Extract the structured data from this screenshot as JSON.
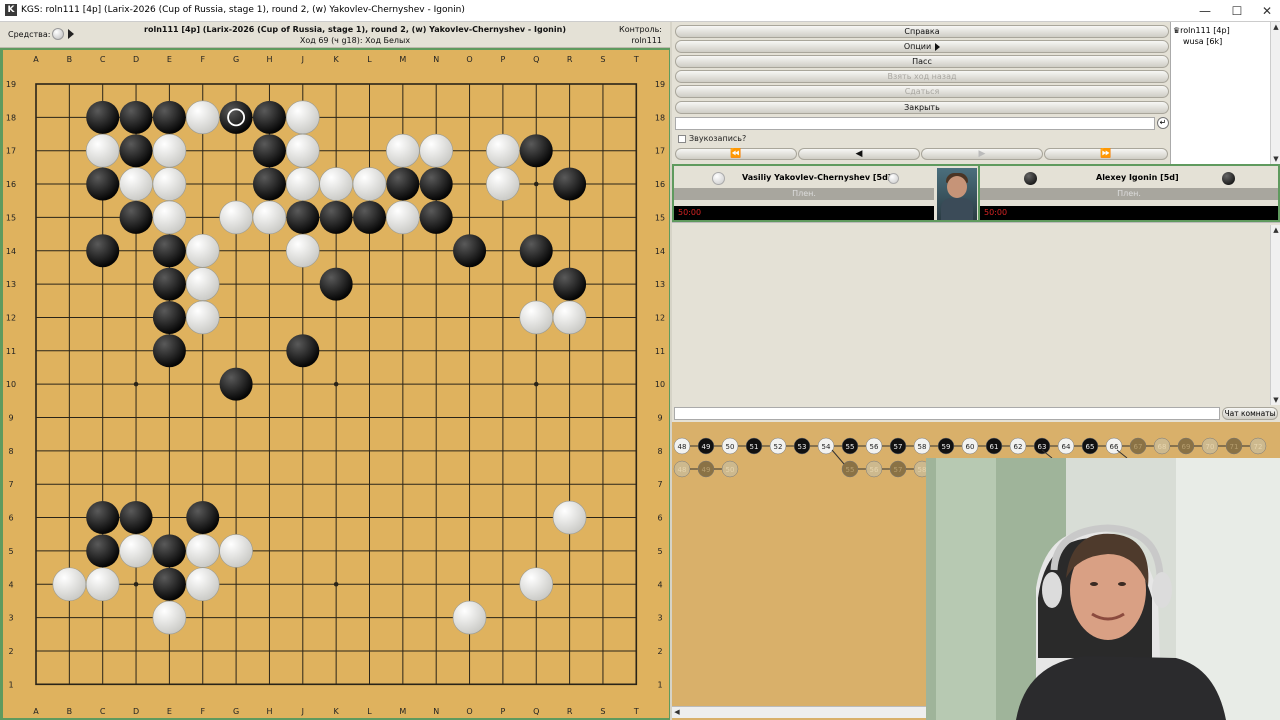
{
  "window": {
    "title": "KGS: roln111 [4p] (Larix-2026 (Cup of Russia, stage 1), round 2, (w) Yakovlev-Chernyshev - Igonin)",
    "app_icon": "K",
    "minimize_icon": "minimize-icon",
    "maximize_icon": "maximize-icon",
    "close_icon": "close-icon"
  },
  "header": {
    "tools_label": "Средства:",
    "game_title": "roln111 [4p] (Larix-2026 (Cup of Russia, stage 1), round 2, (w) Yakovlev-Chernyshev - Igonin)",
    "move_info": "Ход 69 (ч g18): Ход Белых",
    "control_label": "Контроль:",
    "control_user": "roln111"
  },
  "board": {
    "size": 19,
    "columns": [
      "A",
      "B",
      "C",
      "D",
      "E",
      "F",
      "G",
      "H",
      "J",
      "K",
      "L",
      "M",
      "N",
      "O",
      "P",
      "Q",
      "R",
      "S",
      "T"
    ],
    "rows": [
      "19",
      "18",
      "17",
      "16",
      "15",
      "14",
      "13",
      "12",
      "11",
      "10",
      "9",
      "8",
      "7",
      "6",
      "5",
      "4",
      "3",
      "2",
      "1"
    ],
    "black_stones": [
      "C18",
      "D18",
      "E18",
      "G18",
      "H18",
      "D17",
      "H17",
      "Q17",
      "C16",
      "H16",
      "M16",
      "N16",
      "R16",
      "D15",
      "J15",
      "K15",
      "L15",
      "N15",
      "C14",
      "E14",
      "O14",
      "Q14",
      "E13",
      "K13",
      "R13",
      "E12",
      "E11",
      "J11",
      "G10",
      "C6",
      "D6",
      "F6",
      "C5",
      "E5",
      "E4"
    ],
    "white_stones": [
      "F18",
      "J18",
      "C17",
      "E17",
      "J17",
      "M17",
      "N17",
      "P17",
      "D16",
      "E16",
      "J16",
      "K16",
      "L16",
      "P16",
      "E15",
      "G15",
      "H15",
      "M15",
      "F14",
      "J14",
      "F13",
      "F12",
      "Q12",
      "R12",
      "R6",
      "D5",
      "F5",
      "G5",
      "B4",
      "C4",
      "F4",
      "Q4",
      "E3",
      "O3"
    ],
    "last_move": "G18",
    "colors": {
      "wood": "#dfb25e",
      "frame": "#5f9a5e",
      "line": "#2a2418"
    }
  },
  "controls": {
    "help": "Справка",
    "options": "Опции",
    "pass": "Пасс",
    "undo": "Взять ход назад",
    "resign": "Сдаться",
    "close": "Закрыть",
    "sound_record": "Звукозапись?",
    "nav_first": "⏪",
    "nav_prev": "◀",
    "nav_next": "▶",
    "nav_last": "⏩"
  },
  "observers": [
    "roln111 [4p]",
    "wusa [6k]"
  ],
  "players": {
    "white": {
      "name": "Vasiliy Yakovlev-Chernyshev [5d]",
      "captures_label": "Плен.",
      "clock": "50:00"
    },
    "black": {
      "name": "Alexey Igonin [5d]",
      "captures_label": "Плен.",
      "clock": "50:00"
    }
  },
  "chat": {
    "room_button": "Чат комнаты"
  },
  "game_tree": {
    "main_line": [
      {
        "n": "48",
        "c": "w"
      },
      {
        "n": "49",
        "c": "b"
      },
      {
        "n": "50",
        "c": "w"
      },
      {
        "n": "51",
        "c": "b"
      },
      {
        "n": "52",
        "c": "w"
      },
      {
        "n": "53",
        "c": "b"
      },
      {
        "n": "54",
        "c": "w"
      },
      {
        "n": "55",
        "c": "b"
      },
      {
        "n": "56",
        "c": "w"
      },
      {
        "n": "57",
        "c": "b"
      },
      {
        "n": "58",
        "c": "w"
      },
      {
        "n": "59",
        "c": "b"
      },
      {
        "n": "60",
        "c": "w"
      },
      {
        "n": "61",
        "c": "b"
      },
      {
        "n": "62",
        "c": "w"
      },
      {
        "n": "63",
        "c": "b"
      },
      {
        "n": "64",
        "c": "w"
      },
      {
        "n": "65",
        "c": "b"
      },
      {
        "n": "66",
        "c": "w"
      },
      {
        "n": "67",
        "c": "fb"
      },
      {
        "n": "68",
        "c": "fw"
      },
      {
        "n": "69",
        "c": "fb"
      },
      {
        "n": "70",
        "c": "fw"
      },
      {
        "n": "71",
        "c": "fb"
      },
      {
        "n": "72",
        "c": "fw"
      }
    ],
    "branch_a": [
      {
        "n": "48",
        "c": "fw"
      },
      {
        "n": "49",
        "c": "fb"
      },
      {
        "n": "50",
        "c": "fw"
      }
    ],
    "branch_b": [
      {
        "n": "55",
        "c": "fb"
      },
      {
        "n": "56",
        "c": "fw"
      },
      {
        "n": "57",
        "c": "fb"
      },
      {
        "n": "58",
        "c": "fw"
      }
    ]
  }
}
